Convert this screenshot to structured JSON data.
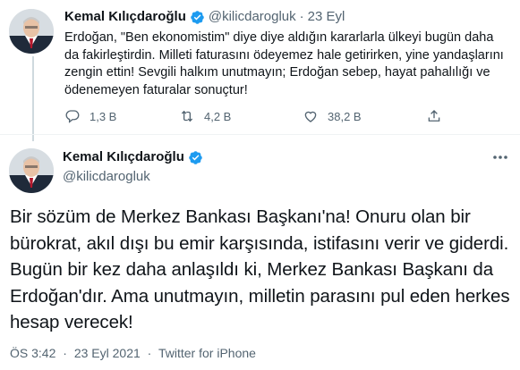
{
  "reply_tweet": {
    "author_name": "Kemal Kılıçdaroğlu",
    "handle": "@kilicdarogluk",
    "separator": "·",
    "date": "23 Eyl",
    "text": "Erdoğan, \"Ben ekonomistim\" diye diye aldığın kararlarla ülkeyi bugün daha da fakirleştirdin. Milleti faturasını ödeyemez hale getirirken, yine yandaşlarını zengin ettin! Sevgili halkım unutmayın; Erdoğan sebep, hayat pahalılığı ve ödenemeyen faturalar sonuçtur!",
    "reply_count": "1,3 B",
    "retweet_count": "4,2 B",
    "like_count": "38,2 B"
  },
  "main_tweet": {
    "author_name": "Kemal Kılıçdaroğlu",
    "handle": "@kilicdarogluk",
    "text": "Bir sözüm de Merkez Bankası Başkanı'na! Onuru olan bir bürokrat, akıl dışı bu emir karşısında, istifasını verir ve giderdi. Bugün bir kez daha anlaşıldı ki, Merkez Bankası Başkanı da Erdoğan'dır. Ama unutmayın, milletin parasını pul eden herkes hesap verecek!",
    "time": "ÖS 3:42",
    "date": "23 Eyl 2021",
    "source": "Twitter for iPhone",
    "separator": "·"
  },
  "colors": {
    "verified": "#1d9bf0",
    "secondary_text": "#536471",
    "thread_line": "#cfd9de"
  },
  "icons": [
    "verified-badge-icon",
    "reply-icon",
    "retweet-icon",
    "like-icon",
    "share-icon",
    "more-options-icon"
  ]
}
